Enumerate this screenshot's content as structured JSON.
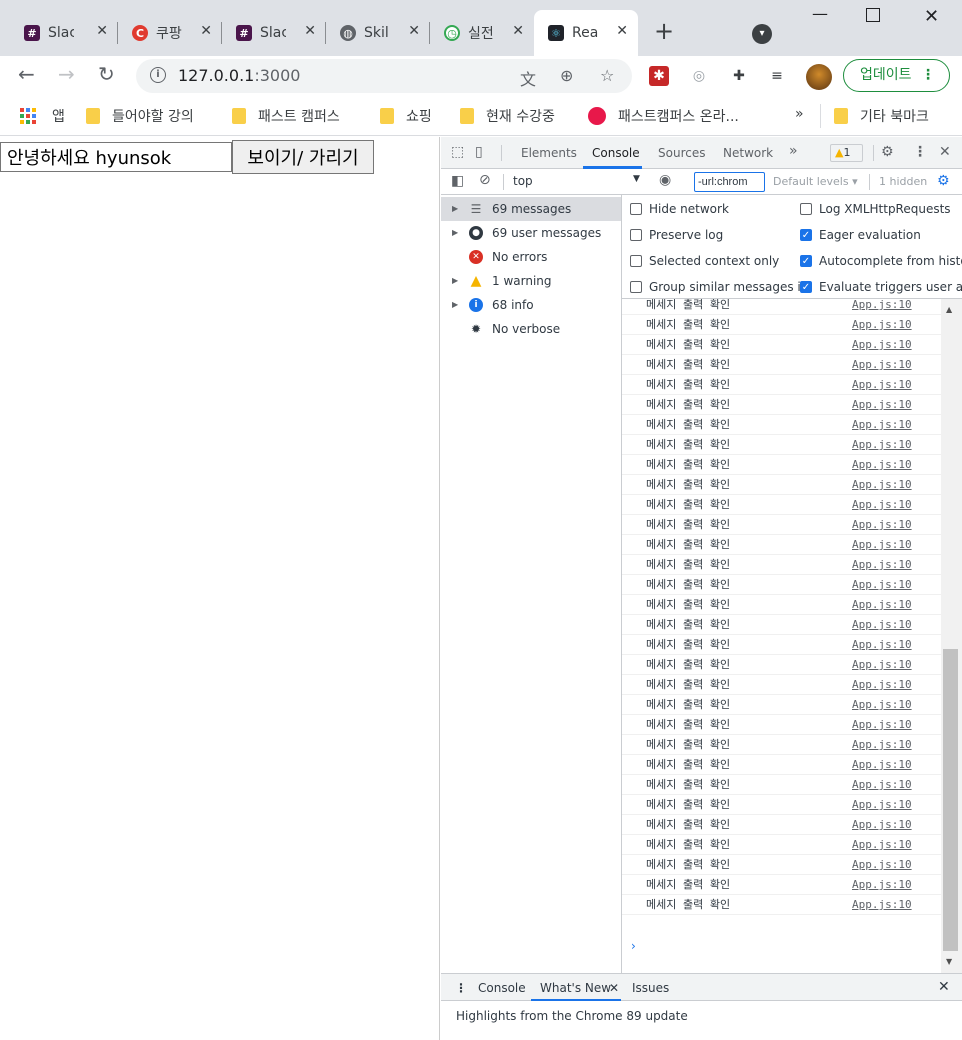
{
  "tabs": [
    {
      "title": "Slac",
      "favicon": "slack-icon",
      "favicon_color": "#4a154b"
    },
    {
      "title": "쿠팡",
      "favicon": "coupang-icon",
      "favicon_color": "#e03a2f"
    },
    {
      "title": "Slac",
      "favicon": "slack-icon",
      "favicon_color": "#4a154b"
    },
    {
      "title": "Skil",
      "favicon": "globe-icon",
      "favicon_color": "#5f6368"
    },
    {
      "title": "실전",
      "favicon": "timer-icon",
      "favicon_color": "#34a853"
    },
    {
      "title": "Rea",
      "favicon": "react-icon",
      "favicon_color": "#20232a",
      "active": true
    }
  ],
  "toolbar": {
    "url_host": "127.0.0.1",
    "url_port": ":3000",
    "update_label": "업데이트"
  },
  "bookmarks": {
    "apps_label": "앱",
    "items": [
      "들어야할 강의",
      "패스트 캠퍼스",
      "쇼핑",
      "현재 수강중",
      "패스트캠퍼스 온라..."
    ],
    "more": "»",
    "other": "기타 북마크"
  },
  "page": {
    "input_value": "안녕하세요 hyunsok",
    "toggle_label": "보이기/ 가리기"
  },
  "devtools": {
    "tabs": [
      "Elements",
      "Console",
      "Sources",
      "Network"
    ],
    "more_tabs": "»",
    "active_tab": "Console",
    "warning_count": "1",
    "context": "top",
    "filter_value": "-url:chrom",
    "levels_label": "Default levels ▾",
    "hidden_label": "1 hidden",
    "sidebar": [
      {
        "label": "69 messages",
        "icon": "list-icon",
        "expandable": true,
        "selected": true
      },
      {
        "label": "69 user messages",
        "icon": "user-icon",
        "expandable": true
      },
      {
        "label": "No errors",
        "icon": "error-icon",
        "expandable": false
      },
      {
        "label": "1 warning",
        "icon": "warning-icon",
        "expandable": true
      },
      {
        "label": "68 info",
        "icon": "info-icon",
        "expandable": true
      },
      {
        "label": "No verbose",
        "icon": "bug-icon",
        "expandable": false
      }
    ],
    "settings": [
      {
        "label": "Hide network",
        "checked": false
      },
      {
        "label": "Log XMLHttpRequests",
        "checked": false
      },
      {
        "label": "Preserve log",
        "checked": false
      },
      {
        "label": "Eager evaluation",
        "checked": true
      },
      {
        "label": "Selected context only",
        "checked": false
      },
      {
        "label": "Autocomplete from history",
        "checked": true
      },
      {
        "label": "Group similar messages in",
        "checked": false
      },
      {
        "label": "Evaluate triggers user activ",
        "checked": true
      }
    ],
    "log_message": "메세지 출력 확인",
    "log_source": "App.js:10",
    "log_lines_visible": 31,
    "prompt": "›",
    "drawer_tabs": [
      "Console",
      "What's New",
      "Issues"
    ],
    "drawer_text": "Highlights from the Chrome 89 update"
  }
}
